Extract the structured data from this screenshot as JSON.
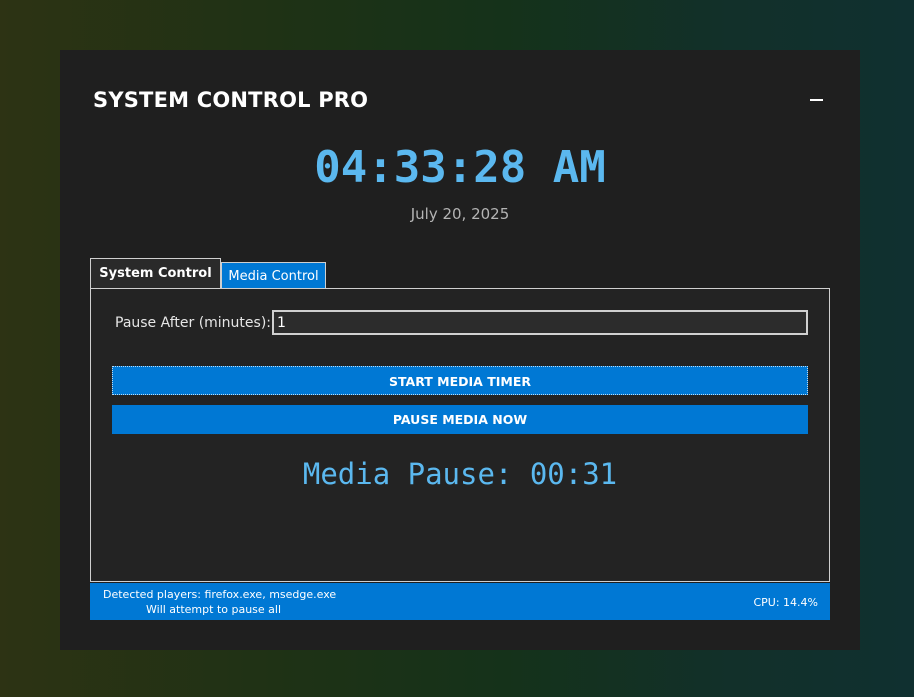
{
  "app": {
    "title": "SYSTEM CONTROL PRO",
    "minimize_icon": "minimize-icon"
  },
  "clock": {
    "time": "04:33:28 AM",
    "date": "July 20, 2025"
  },
  "tabs": [
    {
      "label": "System Control",
      "active": false
    },
    {
      "label": "Media Control",
      "active": true
    }
  ],
  "media": {
    "pause_after_label": "Pause After (minutes):",
    "pause_after_value": "1",
    "start_button": "START MEDIA TIMER",
    "pause_button": "PAUSE MEDIA NOW",
    "countdown": "Media Pause: 00:31"
  },
  "status": {
    "detected": "Detected players: firefox.exe, msedge.exe",
    "attempt": "Will attempt to pause all",
    "cpu": "CPU: 14.4%"
  },
  "colors": {
    "accent": "#0078d4",
    "clock": "#5bb8ef",
    "window_bg": "#1f1f1f",
    "panel_bg": "#232323"
  }
}
